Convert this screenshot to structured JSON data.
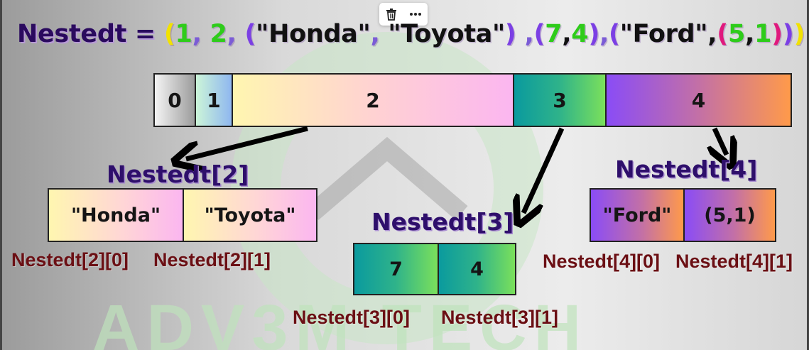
{
  "toolbar": {
    "delete_icon": "trash-icon",
    "more_icon": "more-dots-icon",
    "more_text": "···"
  },
  "title": {
    "name": "Nestedt",
    "eq": " = ",
    "tokens": [
      {
        "text": "(",
        "color": "#f2e200"
      },
      {
        "text": "1",
        "color": "#2ecc1a"
      },
      {
        "text": ", ",
        "color": "#7b5cd6"
      },
      {
        "text": "2",
        "color": "#2ecc1a"
      },
      {
        "text": ", ",
        "color": "#7b5cd6"
      },
      {
        "text": "(",
        "color": "#7b3fe4"
      },
      {
        "text": "\"Honda\"",
        "color": "#111111"
      },
      {
        "text": ", ",
        "color": "#7b5cd6"
      },
      {
        "text": "\"Toyota\"",
        "color": "#111111"
      },
      {
        "text": ") ",
        "color": "#7b3fe4"
      },
      {
        "text": ",",
        "color": "#7b5cd6"
      },
      {
        "text": "(",
        "color": "#7b3fe4"
      },
      {
        "text": "7",
        "color": "#2ecc1a"
      },
      {
        "text": ",",
        "color": "#111111"
      },
      {
        "text": "4",
        "color": "#2ecc1a"
      },
      {
        "text": ")",
        "color": "#7b3fe4"
      },
      {
        "text": ",",
        "color": "#7b5cd6"
      },
      {
        "text": "(",
        "color": "#7b3fe4"
      },
      {
        "text": "\"Ford\"",
        "color": "#111111"
      },
      {
        "text": ",",
        "color": "#111111"
      },
      {
        "text": "(",
        "color": "#e0197d"
      },
      {
        "text": "5",
        "color": "#2ecc1a"
      },
      {
        "text": ",",
        "color": "#111111"
      },
      {
        "text": "1",
        "color": "#2ecc1a"
      },
      {
        "text": ")",
        "color": "#e0197d"
      },
      {
        "text": ")",
        "color": "#7b3fe4"
      },
      {
        "text": ")",
        "color": "#f2e200"
      }
    ]
  },
  "main_tuple": {
    "indices": [
      "0",
      "1",
      "2",
      "3",
      "4"
    ]
  },
  "nested2": {
    "label": "Nestedt[2]",
    "cells": [
      "\"Honda\"",
      "\"Toyota\""
    ],
    "index_labels": [
      "Nestedt[2][0]",
      "Nestedt[2][1]"
    ]
  },
  "nested3": {
    "label": "Nestedt[3]",
    "cells": [
      "7",
      "4"
    ],
    "index_labels": [
      "Nestedt[3][0]",
      "Nestedt[3][1]"
    ]
  },
  "nested4": {
    "label": "Nestedt[4]",
    "cells": [
      "\"Ford\"",
      "(5,1)"
    ],
    "index_labels": [
      "Nestedt[4][0]",
      "Nestedt[4][1]"
    ]
  },
  "colors": {
    "label": "#2e0f6b",
    "index_label": "#6b0f14",
    "arrow": "#000000",
    "cell_pink": "#fbb6f0",
    "cell_yellow": "#fff7b0",
    "cell_teal": "#0f9a9a",
    "cell_green": "#7be05b",
    "cell_purple": "#8a4cf6",
    "cell_orange": "#ff9a4a"
  }
}
